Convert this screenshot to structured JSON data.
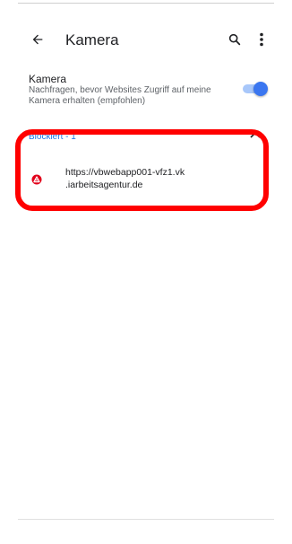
{
  "toolbar": {
    "title": "Kamera",
    "back_icon": "arrow-left-icon",
    "search_icon": "search-icon",
    "more_icon": "more-vert-icon"
  },
  "setting": {
    "title": "Kamera",
    "summary": "Nachfragen, bevor Websites Zugriff auf meine Kamera erhalten (empfohlen)",
    "toggle_on": true,
    "accent_color": "#3a76f0"
  },
  "blocked_section": {
    "label": "Blockiert - 1",
    "collapse_icon": "chevron-up-icon",
    "label_color": "#1a73e8"
  },
  "sites": [
    {
      "url": "https://vbwebapp001-vfz1.vk .iarbeitsagentur.de",
      "icon": "arbeitsagentur-logo-icon",
      "icon_color": "#e2001a"
    }
  ],
  "annotation": {
    "highlight_color": "#ff0000"
  }
}
